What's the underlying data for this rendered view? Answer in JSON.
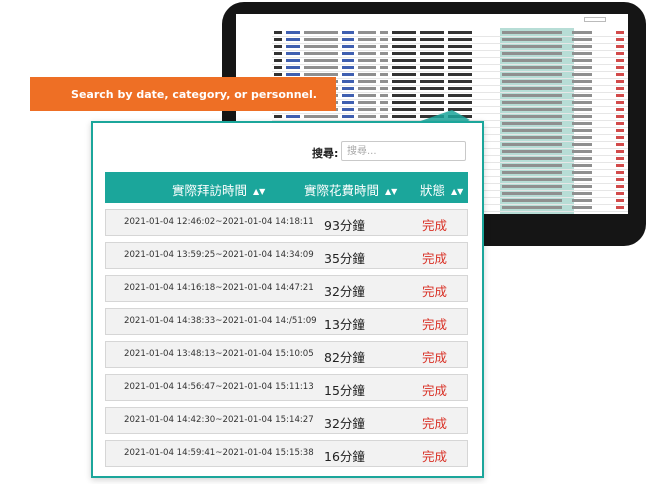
{
  "banner": {
    "text": "Search by date, category, or personnel."
  },
  "search": {
    "label": "搜尋:",
    "placeholder": "搜尋..."
  },
  "table": {
    "columns": [
      {
        "label": "實際拜訪時間",
        "sort_icon": "sort-updown-icon"
      },
      {
        "label": "實際花費時間",
        "sort_icon": "sort-updown-icon"
      },
      {
        "label": "狀態",
        "sort_icon": "sort-updown-icon"
      }
    ],
    "rows": [
      {
        "time": "2021-01-04  12:46:02~2021-01-04  14:18:11",
        "duration": "93分鐘",
        "status": "完成"
      },
      {
        "time": "2021-01-04  13:59:25~2021-01-04  14:34:09",
        "duration": "35分鐘",
        "status": "完成"
      },
      {
        "time": "2021-01-04  14:16:18~2021-01-04  14:47:21",
        "duration": "32分鐘",
        "status": "完成"
      },
      {
        "time": "2021-01-04 14:38:33~2021-01-04  14:/51:09",
        "duration": "13分鐘",
        "status": "完成"
      },
      {
        "time": "2021-01-04 13:48:13~2021-01-04  15:10:05",
        "duration": "82分鐘",
        "status": "完成"
      },
      {
        "time": "2021-01-04  14:56:47~2021-01-04  15:11:13",
        "duration": "15分鐘",
        "status": "完成"
      },
      {
        "time": "2021-01-04  14:42:30~2021-01-04  15:14:27",
        "duration": "32分鐘",
        "status": "完成"
      },
      {
        "time": "2021-01-04  14:59:41~2021-01-04  15:15:38",
        "duration": "16分鐘",
        "status": "完成"
      }
    ]
  },
  "colors": {
    "accent": "#1ba69b",
    "banner": "#ee6f25",
    "status_done": "#d93025",
    "device": "#151515"
  }
}
